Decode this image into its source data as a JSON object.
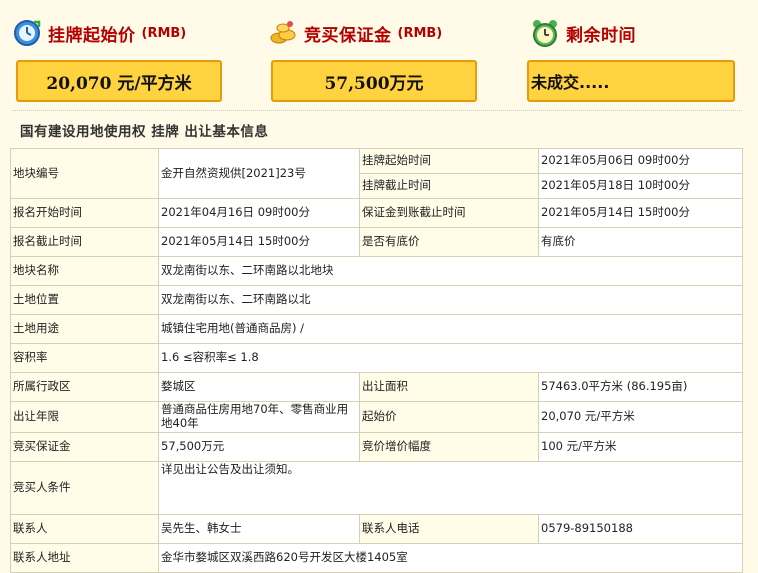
{
  "header": {
    "start_price_label": "挂牌起始价",
    "start_price_unit": "(RMB)",
    "deposit_label": "竞买保证金",
    "deposit_unit": "(RMB)",
    "remaining_label": "剩余时间",
    "start_price_value": "20,070 元/平方米",
    "deposit_value": "57,500万元",
    "remaining_value": "未成交....."
  },
  "section": {
    "title": "国有建设用地使用权 挂牌 出让基本信息"
  },
  "table": {
    "r1": {
      "l1": "地块编号",
      "v1": "金开自然资规供[2021]23号",
      "l2a": "挂牌起始时间",
      "v2a": "2021年05月06日 09时00分",
      "l2b": "挂牌截止时间",
      "v2b": "2021年05月18日 10时00分"
    },
    "r2": {
      "l1": "报名开始时间",
      "v1": "2021年04月16日 09时00分",
      "l2": "保证金到账截止时间",
      "v2": "2021年05月14日 15时00分"
    },
    "r3": {
      "l1": "报名截止时间",
      "v1": "2021年05月14日 15时00分",
      "l2": "是否有底价",
      "v2": "有底价"
    },
    "r4": {
      "l1": "地块名称",
      "v1": "双龙南街以东、二环南路以北地块"
    },
    "r5": {
      "l1": "土地位置",
      "v1": "双龙南街以东、二环南路以北"
    },
    "r6": {
      "l1": "土地用途",
      "v1": "城镇住宅用地(普通商品房) /"
    },
    "r7": {
      "l1": "容积率",
      "v1": "1.6 ≤容积率≤ 1.8"
    },
    "r8": {
      "l1": "所属行政区",
      "v1": "婺城区",
      "l2": "出让面积",
      "v2": "57463.0平方米 (86.195亩)"
    },
    "r9": {
      "l1": "出让年限",
      "v1": "普通商品住房用地70年、零售商业用地40年",
      "l2": "起始价",
      "v2": "20,070 元/平方米"
    },
    "r10": {
      "l1": "竞买保证金",
      "v1": "57,500万元",
      "l2": "竞价增价幅度",
      "v2": "100 元/平方米"
    },
    "r11": {
      "l1": "竞买人条件",
      "v1": "详见出让公告及出让须知。"
    },
    "r12": {
      "l1": "联系人",
      "v1": "吴先生、韩女士",
      "l2": "联系人电话",
      "v2": "0579-89150188"
    },
    "r13": {
      "l1": "联系人地址",
      "v1": "金华市婺城区双溪西路620号开发区大楼1405室"
    }
  },
  "colors": {
    "accent_red": "#b40000",
    "box_fill": "#ffd23f",
    "box_border": "#e59a10",
    "page_bg": "#fffbe8"
  }
}
